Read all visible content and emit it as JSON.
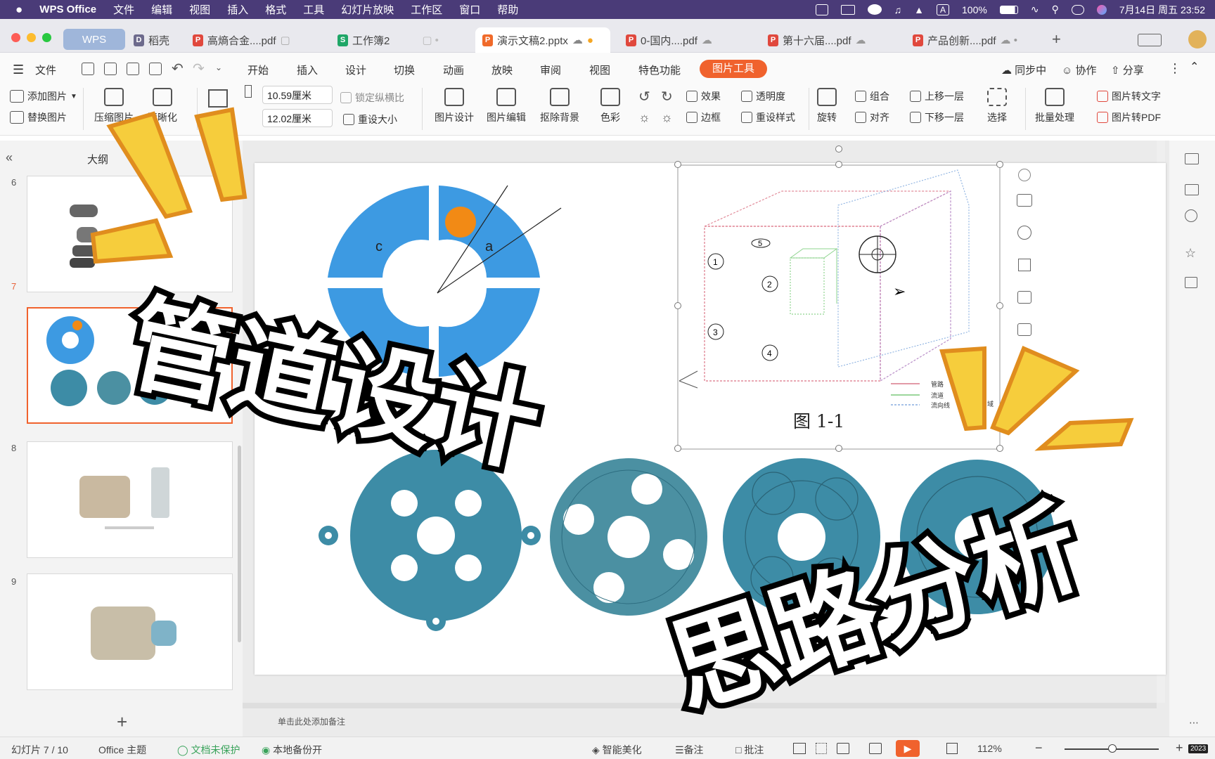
{
  "menubar": {
    "app_name": "WPS Office",
    "items": [
      "文件",
      "编辑",
      "视图",
      "插入",
      "格式",
      "工具",
      "幻灯片放映",
      "工作区",
      "窗口",
      "帮助"
    ],
    "battery": "100%",
    "input_method": "A",
    "datetime": "7月14日 周五  23:52"
  },
  "tabs": [
    {
      "label": "WPS",
      "kind": "home"
    },
    {
      "label": "稻壳",
      "kind": "docer"
    },
    {
      "label": "高熵合金....pdf",
      "kind": "pdf"
    },
    {
      "label": "工作簿2",
      "kind": "sheet"
    },
    {
      "label": "演示文稿2.pptx",
      "kind": "ppt",
      "active": true
    },
    {
      "label": "0-国内....pdf",
      "kind": "pdf"
    },
    {
      "label": "第十六届....pdf",
      "kind": "pdf"
    },
    {
      "label": "产品创新....pdf",
      "kind": "pdf"
    }
  ],
  "ribbon_tabs": {
    "file": "文件",
    "items": [
      "开始",
      "插入",
      "设计",
      "切换",
      "动画",
      "放映",
      "审阅",
      "视图",
      "特色功能"
    ],
    "active": "图片工具",
    "sync": "同步中",
    "collab": "协作",
    "share": "分享"
  },
  "ribbon": {
    "add_picture": "添加图片",
    "replace_picture": "替换图片",
    "compress": "压缩图片",
    "sharpen": "清晰化",
    "width_value": "10.59厘米",
    "height_value": "12.02厘米",
    "lock_ratio": "锁定纵横比",
    "reset_size": "重设大小",
    "pic_design": "图片设计",
    "pic_edit": "图片编辑",
    "remove_bg": "抠除背景",
    "color": "色彩",
    "effect": "效果",
    "transparency": "透明度",
    "border": "边框",
    "reset_style": "重设样式",
    "rotate": "旋转",
    "group": "组合",
    "align": "对齐",
    "bring_forward": "上移一层",
    "send_backward": "下移一层",
    "select": "选择",
    "batch": "批量处理",
    "pic_to_text": "图片转文字",
    "pic_to_pdf": "图片转PDF"
  },
  "left_panel": {
    "header": "大纲",
    "slides": [
      {
        "number": "6"
      },
      {
        "number": "7",
        "selected": true
      },
      {
        "number": "8"
      },
      {
        "number": "9"
      }
    ]
  },
  "slide": {
    "disc_labels": {
      "left": "c",
      "right": "a"
    },
    "figure_caption": "图 1-1",
    "figure_labels": [
      "1",
      "2",
      "3",
      "4",
      "5"
    ],
    "legend": [
      "管路",
      "流道",
      "流向线"
    ],
    "legend_suffix": "域",
    "colors": {
      "blue": "#3d9ae2",
      "teal": "#3d8ca6",
      "teal2": "#4b90a2",
      "orange": "#f28a15"
    }
  },
  "overlay_text": {
    "top": "管道设计",
    "bottom": "思路分析"
  },
  "notes_placeholder": "单击此处添加备注",
  "status": {
    "slide_counter": "幻灯片 7 / 10",
    "theme": "Office 主题",
    "protect": "文档未保护",
    "backup": "本地备份开",
    "beautify": "智能美化",
    "notes": "备注",
    "comment": "批注",
    "zoom": "112%",
    "corner_badge": "2023"
  }
}
